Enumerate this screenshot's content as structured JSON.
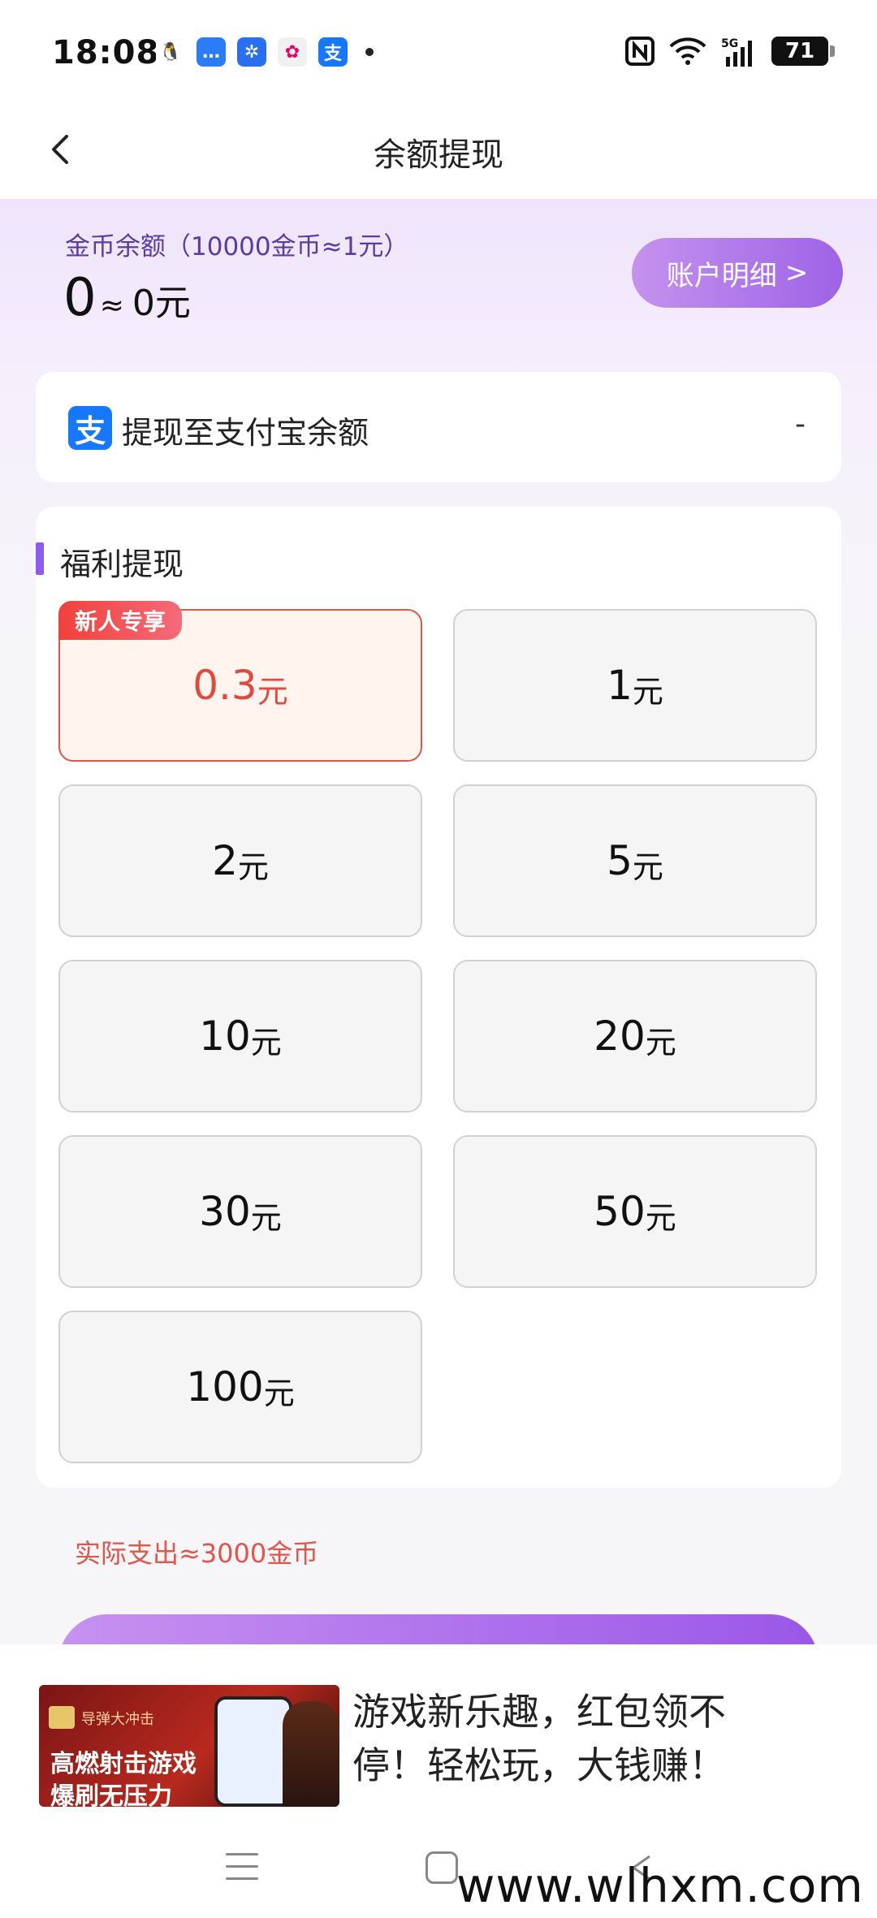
{
  "status_bar": {
    "time": "18:08",
    "battery": "71",
    "network": "5G"
  },
  "header": {
    "title": "余额提现"
  },
  "balance": {
    "label": "金币余额（10000金币≈1元）",
    "coins": "0",
    "approx": "≈",
    "yuan": "0元",
    "account_button": "账户明细",
    "account_chevron": ">"
  },
  "alipay": {
    "label": "提现至支付宝余额",
    "icon_char": "支",
    "value": "-"
  },
  "welfare": {
    "title": "福利提现",
    "unit": "元",
    "badge": "新人专享",
    "options": [
      {
        "amount": "0.3",
        "selected": true
      },
      {
        "amount": "1",
        "selected": false
      },
      {
        "amount": "2",
        "selected": false
      },
      {
        "amount": "5",
        "selected": false
      },
      {
        "amount": "10",
        "selected": false
      },
      {
        "amount": "20",
        "selected": false
      },
      {
        "amount": "30",
        "selected": false
      },
      {
        "amount": "50",
        "selected": false
      },
      {
        "amount": "100",
        "selected": false
      }
    ]
  },
  "expense_note": "实际支出≈3000金币",
  "ad": {
    "brand": "导弹大冲击",
    "line1": "高燃射击游戏",
    "line2": "爆刷无压力",
    "text": "游戏新乐趣，红包领不停！轻松玩，大钱赚！"
  },
  "watermark": "www.wlhxm.com",
  "colors": {
    "accent_purple": "#9e63e6",
    "selected_red": "#e34a3f",
    "alipay_blue": "#1677ff"
  }
}
